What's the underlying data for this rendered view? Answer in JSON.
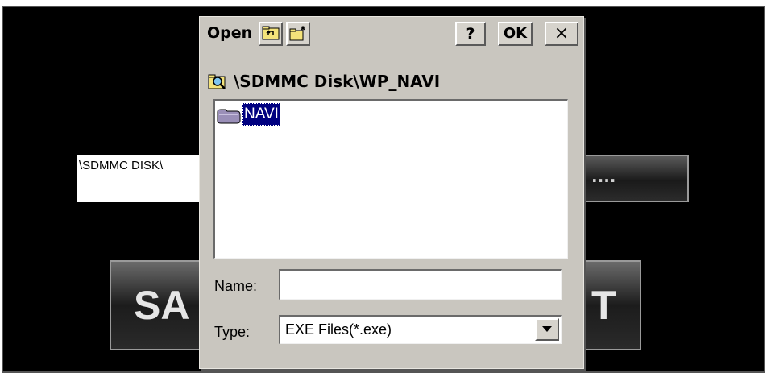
{
  "background": {
    "path_field_text": "\\SDMMC DISK\\",
    "browse_label": "....",
    "left_big_button": "SA",
    "right_big_button": "T"
  },
  "dialog": {
    "title": "Open",
    "help_label": "?",
    "ok_label": "OK",
    "close_label": "×",
    "location": "\\SDMMC Disk\\WP_NAVI",
    "items": [
      {
        "label": "NAVI",
        "icon": "folder-icon",
        "selected": true
      }
    ],
    "name_label": "Name:",
    "name_value": "",
    "type_label": "Type:",
    "type_value": "EXE Files(*.exe)"
  },
  "colors": {
    "selection": "#000080",
    "dialog_bg": "#c9c6bf",
    "screen_bg": "#000000"
  }
}
